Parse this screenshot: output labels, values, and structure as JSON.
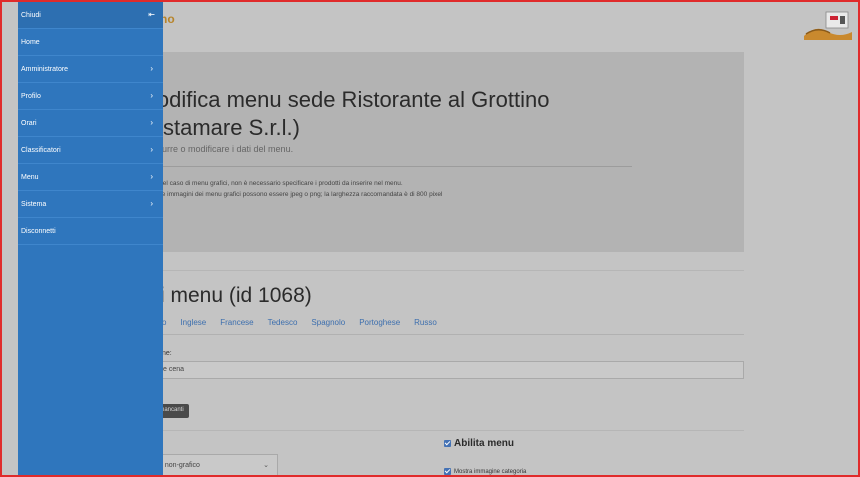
{
  "header": {
    "brand": "no",
    "logo_icon": "restaurant-logo-icon"
  },
  "sidebar": {
    "items": [
      {
        "label": "Chiudi",
        "icon": "pin-icon"
      },
      {
        "label": "Home",
        "icon": ""
      },
      {
        "label": "Amministratore",
        "icon": "chevron-right-icon"
      },
      {
        "label": "Profilo",
        "icon": "chevron-right-icon"
      },
      {
        "label": "Orari",
        "icon": "chevron-right-icon"
      },
      {
        "label": "Classificatori",
        "icon": "chevron-right-icon"
      },
      {
        "label": "Menu",
        "icon": "chevron-right-icon"
      },
      {
        "label": "Sistema",
        "icon": "chevron-right-icon"
      },
      {
        "label": "Disconnetti",
        "icon": ""
      }
    ]
  },
  "jumbotron": {
    "title_line1": "lodifica menu sede Ristorante al Grottino",
    "title_line2": "/istamare S.r.l.)",
    "lead": "odurre o modificare i dati del menu.",
    "notes": [
      "Nel caso di menu grafici, non è necessario specificare i prodotti da inserire nel menu.",
      "Le immagini dei menu grafici possono essere jpeg o png; la larghezza raccomandata è di 800 pixel"
    ]
  },
  "section": {
    "title": "i menu (id 1068)",
    "tabs": [
      "o",
      "Inglese",
      "Francese",
      "Tedesco",
      "Spagnolo",
      "Portoghese",
      "Russo"
    ],
    "nome_label": "ne:",
    "nome_value": "e cena",
    "btn_mancanti": "nancanti",
    "abilita_menu": "Abilita menu",
    "mostra_immagine": "Mostra immagine categoria",
    "tipo_value": "t non-grafico"
  },
  "colors": {
    "sidebar_bg": "#2f76bd",
    "frame_border": "#e02b2b",
    "tab_link": "#3d6fae",
    "brand": "#b7842a"
  }
}
